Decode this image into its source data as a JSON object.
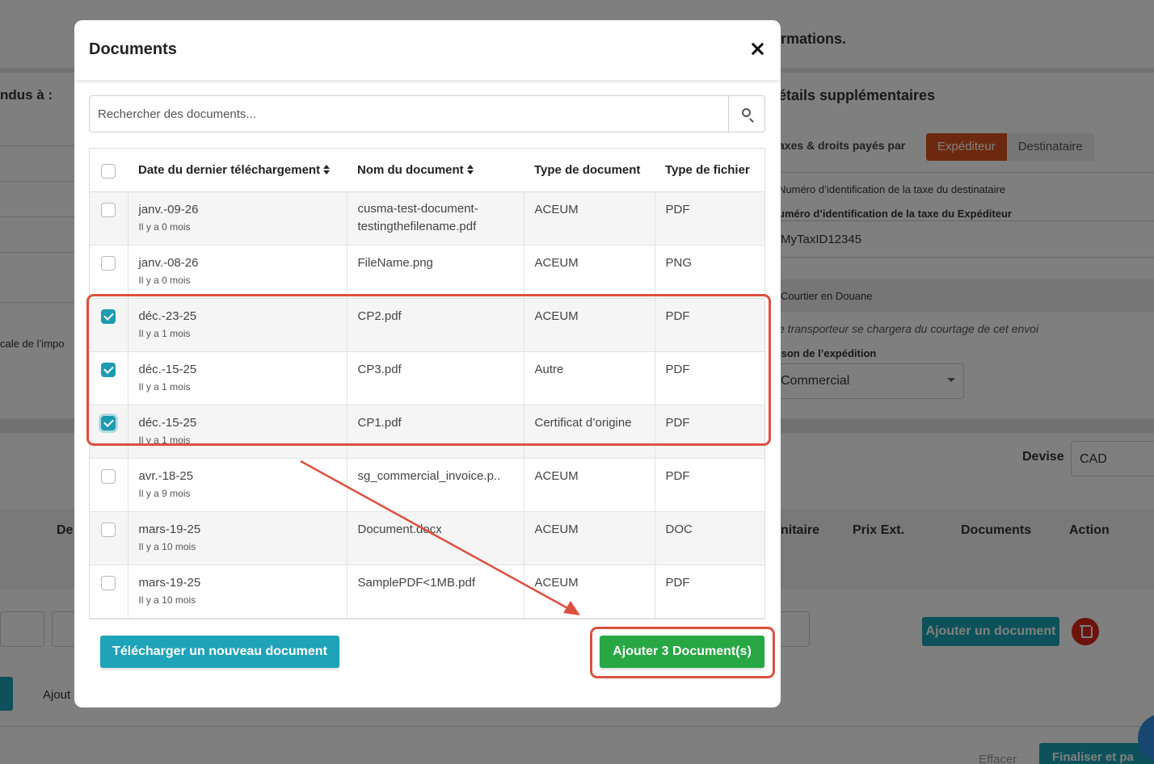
{
  "background": {
    "header_partial": "rmations.",
    "left_label": "ndus à :",
    "left_text": "cale de l’impo",
    "section_title": "étails supplémentaires",
    "taxes_label": "axes & droits payés par",
    "payer_options": [
      "Expéditeur",
      "Destinataire"
    ],
    "recipient_tax_label": "Numéro d’identification de la taxe du destinataire",
    "sender_tax_label": "uméro d’identification de la taxe du Expéditeur",
    "sender_tax_value": "MyTaxID12345",
    "broker_label": "Courtier en Douane",
    "broker_note": "e transporteur se chargera du courtage de cet envoi",
    "reason_label": "ison de l’expédition",
    "reason_value": "Commercial",
    "currency_label": "Devise",
    "currency_value": "CAD",
    "table_headers": [
      "De",
      "nitaire",
      "Prix Ext.",
      "Documents",
      "Action"
    ],
    "add_document_label": "Ajouter un document",
    "ajout_text": "Ajout",
    "clear_label": "Effacer",
    "finalize_label": "Finaliser et pa"
  },
  "modal": {
    "title": "Documents",
    "search_placeholder": "Rechercher des documents...",
    "columns": {
      "date": "Date du dernier téléchargement",
      "name": "Nom du document",
      "type": "Type de document",
      "file_type": "Type de fichier"
    },
    "rows": [
      {
        "date": "janv.-09-26",
        "ago": "Il y a 0 mois",
        "name": "cusma-test-document-testingthefilename.pdf",
        "doc_type": "ACEUM",
        "file_type": "PDF",
        "checked": false
      },
      {
        "date": "janv.-08-26",
        "ago": "Il y a 0 mois",
        "name": "FileName.png",
        "doc_type": "ACEUM",
        "file_type": "PNG",
        "checked": false
      },
      {
        "date": "déc.-23-25",
        "ago": "Il y a 1 mois",
        "name": "CP2.pdf",
        "doc_type": "ACEUM",
        "file_type": "PDF",
        "checked": true
      },
      {
        "date": "déc.-15-25",
        "ago": "Il y a 1 mois",
        "name": "CP3.pdf",
        "doc_type": "Autre",
        "file_type": "PDF",
        "checked": true
      },
      {
        "date": "déc.-15-25",
        "ago": "Il y a 1 mois",
        "name": "CP1.pdf",
        "doc_type": "Certificat d’origine",
        "file_type": "PDF",
        "checked": true
      },
      {
        "date": "avr.-18-25",
        "ago": "Il y a 9 mois",
        "name": "sg_commercial_invoice.p..",
        "doc_type": "ACEUM",
        "file_type": "PDF",
        "checked": false
      },
      {
        "date": "mars-19-25",
        "ago": "Il y a 10 mois",
        "name": "Document.docx",
        "doc_type": "ACEUM",
        "file_type": "DOC",
        "checked": false
      },
      {
        "date": "mars-19-25",
        "ago": "Il y a 10 mois",
        "name": "SamplePDF<1MB.pdf",
        "doc_type": "ACEUM",
        "file_type": "PDF",
        "checked": false
      }
    ],
    "upload_button": "Télécharger un nouveau document",
    "add_button": "Ajouter 3 Document(s)"
  },
  "colors": {
    "accent_teal": "#1fa3b8",
    "add_green": "#28a745",
    "annotation_red": "#dc5040",
    "sender_orange": "#d9531e"
  }
}
